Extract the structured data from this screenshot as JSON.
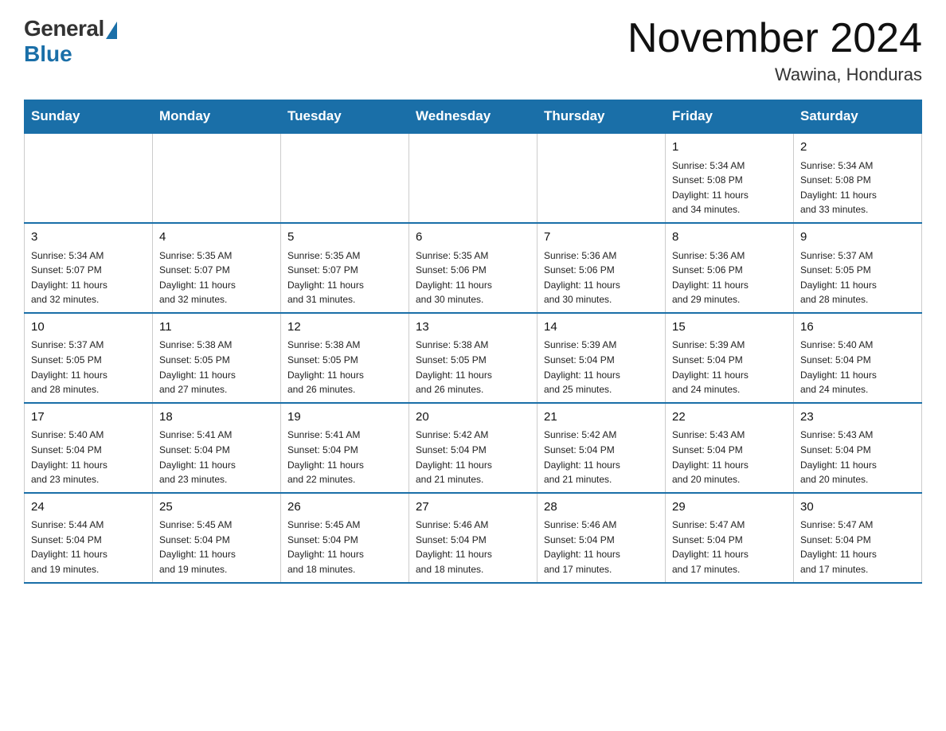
{
  "header": {
    "logo_general": "General",
    "logo_blue": "Blue",
    "month_title": "November 2024",
    "location": "Wawina, Honduras"
  },
  "weekdays": [
    "Sunday",
    "Monday",
    "Tuesday",
    "Wednesday",
    "Thursday",
    "Friday",
    "Saturday"
  ],
  "weeks": [
    [
      {
        "day": "",
        "info": ""
      },
      {
        "day": "",
        "info": ""
      },
      {
        "day": "",
        "info": ""
      },
      {
        "day": "",
        "info": ""
      },
      {
        "day": "",
        "info": ""
      },
      {
        "day": "1",
        "info": "Sunrise: 5:34 AM\nSunset: 5:08 PM\nDaylight: 11 hours\nand 34 minutes."
      },
      {
        "day": "2",
        "info": "Sunrise: 5:34 AM\nSunset: 5:08 PM\nDaylight: 11 hours\nand 33 minutes."
      }
    ],
    [
      {
        "day": "3",
        "info": "Sunrise: 5:34 AM\nSunset: 5:07 PM\nDaylight: 11 hours\nand 32 minutes."
      },
      {
        "day": "4",
        "info": "Sunrise: 5:35 AM\nSunset: 5:07 PM\nDaylight: 11 hours\nand 32 minutes."
      },
      {
        "day": "5",
        "info": "Sunrise: 5:35 AM\nSunset: 5:07 PM\nDaylight: 11 hours\nand 31 minutes."
      },
      {
        "day": "6",
        "info": "Sunrise: 5:35 AM\nSunset: 5:06 PM\nDaylight: 11 hours\nand 30 minutes."
      },
      {
        "day": "7",
        "info": "Sunrise: 5:36 AM\nSunset: 5:06 PM\nDaylight: 11 hours\nand 30 minutes."
      },
      {
        "day": "8",
        "info": "Sunrise: 5:36 AM\nSunset: 5:06 PM\nDaylight: 11 hours\nand 29 minutes."
      },
      {
        "day": "9",
        "info": "Sunrise: 5:37 AM\nSunset: 5:05 PM\nDaylight: 11 hours\nand 28 minutes."
      }
    ],
    [
      {
        "day": "10",
        "info": "Sunrise: 5:37 AM\nSunset: 5:05 PM\nDaylight: 11 hours\nand 28 minutes."
      },
      {
        "day": "11",
        "info": "Sunrise: 5:38 AM\nSunset: 5:05 PM\nDaylight: 11 hours\nand 27 minutes."
      },
      {
        "day": "12",
        "info": "Sunrise: 5:38 AM\nSunset: 5:05 PM\nDaylight: 11 hours\nand 26 minutes."
      },
      {
        "day": "13",
        "info": "Sunrise: 5:38 AM\nSunset: 5:05 PM\nDaylight: 11 hours\nand 26 minutes."
      },
      {
        "day": "14",
        "info": "Sunrise: 5:39 AM\nSunset: 5:04 PM\nDaylight: 11 hours\nand 25 minutes."
      },
      {
        "day": "15",
        "info": "Sunrise: 5:39 AM\nSunset: 5:04 PM\nDaylight: 11 hours\nand 24 minutes."
      },
      {
        "day": "16",
        "info": "Sunrise: 5:40 AM\nSunset: 5:04 PM\nDaylight: 11 hours\nand 24 minutes."
      }
    ],
    [
      {
        "day": "17",
        "info": "Sunrise: 5:40 AM\nSunset: 5:04 PM\nDaylight: 11 hours\nand 23 minutes."
      },
      {
        "day": "18",
        "info": "Sunrise: 5:41 AM\nSunset: 5:04 PM\nDaylight: 11 hours\nand 23 minutes."
      },
      {
        "day": "19",
        "info": "Sunrise: 5:41 AM\nSunset: 5:04 PM\nDaylight: 11 hours\nand 22 minutes."
      },
      {
        "day": "20",
        "info": "Sunrise: 5:42 AM\nSunset: 5:04 PM\nDaylight: 11 hours\nand 21 minutes."
      },
      {
        "day": "21",
        "info": "Sunrise: 5:42 AM\nSunset: 5:04 PM\nDaylight: 11 hours\nand 21 minutes."
      },
      {
        "day": "22",
        "info": "Sunrise: 5:43 AM\nSunset: 5:04 PM\nDaylight: 11 hours\nand 20 minutes."
      },
      {
        "day": "23",
        "info": "Sunrise: 5:43 AM\nSunset: 5:04 PM\nDaylight: 11 hours\nand 20 minutes."
      }
    ],
    [
      {
        "day": "24",
        "info": "Sunrise: 5:44 AM\nSunset: 5:04 PM\nDaylight: 11 hours\nand 19 minutes."
      },
      {
        "day": "25",
        "info": "Sunrise: 5:45 AM\nSunset: 5:04 PM\nDaylight: 11 hours\nand 19 minutes."
      },
      {
        "day": "26",
        "info": "Sunrise: 5:45 AM\nSunset: 5:04 PM\nDaylight: 11 hours\nand 18 minutes."
      },
      {
        "day": "27",
        "info": "Sunrise: 5:46 AM\nSunset: 5:04 PM\nDaylight: 11 hours\nand 18 minutes."
      },
      {
        "day": "28",
        "info": "Sunrise: 5:46 AM\nSunset: 5:04 PM\nDaylight: 11 hours\nand 17 minutes."
      },
      {
        "day": "29",
        "info": "Sunrise: 5:47 AM\nSunset: 5:04 PM\nDaylight: 11 hours\nand 17 minutes."
      },
      {
        "day": "30",
        "info": "Sunrise: 5:47 AM\nSunset: 5:04 PM\nDaylight: 11 hours\nand 17 minutes."
      }
    ]
  ]
}
